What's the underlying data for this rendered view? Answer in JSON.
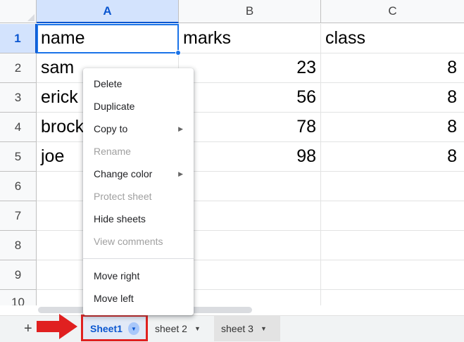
{
  "columns": [
    "A",
    "B",
    "C"
  ],
  "rows": [
    "1",
    "2",
    "3",
    "4",
    "5",
    "6",
    "7",
    "8",
    "9",
    "10"
  ],
  "cells": {
    "A1": "name",
    "B1": "marks",
    "C1": "class",
    "A2": "sam",
    "B2": "23",
    "C2": "8",
    "A3": "erick",
    "B3": "56",
    "C3": "8",
    "A4": "brock",
    "B4": "78",
    "C4": "8",
    "A5": "joe",
    "B5": "98",
    "C5": "8"
  },
  "context_menu": {
    "delete": "Delete",
    "duplicate": "Duplicate",
    "copy_to": "Copy to",
    "rename": "Rename",
    "change_color": "Change color",
    "protect_sheet": "Protect sheet",
    "hide_sheets": "Hide sheets",
    "view_comments": "View comments",
    "move_right": "Move right",
    "move_left": "Move left"
  },
  "sheet_bar": {
    "add_label": "+",
    "tabs": [
      "Sheet1",
      "sheet 2",
      "sheet 3"
    ]
  },
  "icons": {
    "submenu": "caret-right-icon",
    "tab_menu": "caret-down-icon",
    "annotation": "red-arrow-icon"
  },
  "colors": {
    "selection": "#1a73e8",
    "active_tab": "#0b57d0",
    "annotation": "#e02020"
  }
}
